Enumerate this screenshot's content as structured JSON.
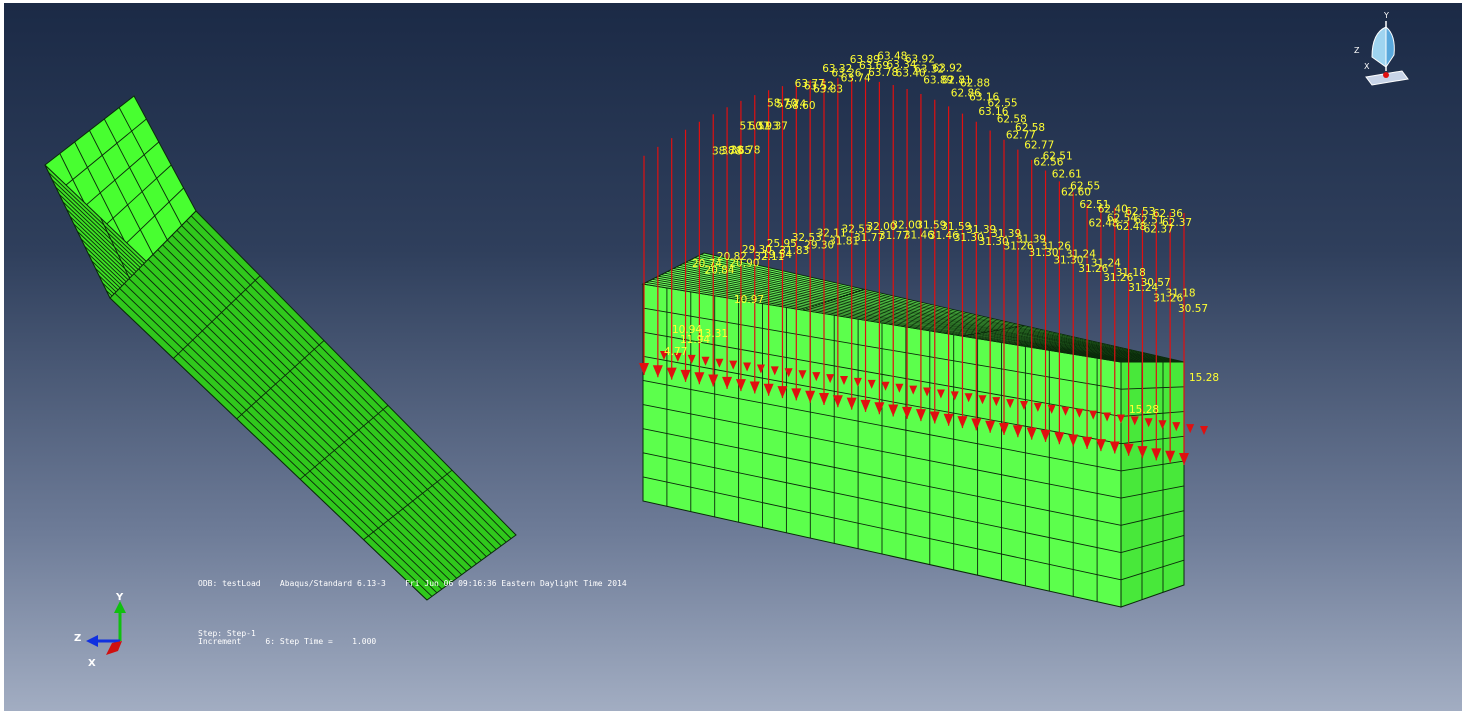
{
  "viewport": {
    "background_top": "#1b2a46",
    "background_bottom": "#a2adc2",
    "mesh_color": "#4cff44",
    "load_color": "#e01010",
    "label_color": "#ffff33"
  },
  "odb_info": {
    "line": "ODB: testLoad    Abaqus/Standard 6.13-3    Fri Jun 06 09:16:36 Eastern Daylight Time 2014"
  },
  "step_info": {
    "step": "Step: Step-1",
    "increment": "Increment     6: Step Time =    1.000"
  },
  "triad": {
    "x": "X",
    "y": "Y",
    "z": "Z"
  },
  "view_cube": {
    "x": "X",
    "y": "Y",
    "z": "Z"
  },
  "load_labels": {
    "top_row": [
      "38.78",
      "38.65",
      "38.78",
      "51.37",
      "50.93",
      "51.37",
      "58.70",
      "57.74",
      "58.60",
      "63.77",
      "63.52",
      "63.83",
      "63.32",
      "63.26",
      "63.74",
      "63.89",
      "63.69",
      "63.78",
      "63.48",
      "63.34",
      "63.40",
      "63.92",
      "63.32",
      "63.89",
      "63.92",
      "62.81",
      "62.86",
      "62.88",
      "63.16",
      "63.16",
      "62.55",
      "62.58",
      "62.77",
      "62.58",
      "62.77",
      "62.56",
      "62.51",
      "62.61",
      "62.60",
      "62.55",
      "62.51",
      "62.48",
      "62.40",
      "62.54",
      "62.48",
      "62.53",
      "62.51",
      "62.37",
      "62.36",
      "62.37"
    ],
    "middle_row": [
      "20.74",
      "20.84",
      "20.82",
      "20.90",
      "29.30",
      "32.11",
      "25.95",
      "31.83",
      "32.53",
      "29.30",
      "32.11",
      "31.81",
      "32.53",
      "31.77",
      "32.00",
      "31.77",
      "32.00",
      "31.46",
      "31.59",
      "31.46",
      "31.59",
      "31.30",
      "31.39",
      "31.30",
      "31.39",
      "31.26",
      "31.39",
      "31.30",
      "31.26",
      "31.30",
      "31.24",
      "31.26",
      "31.24",
      "31.26",
      "31.18",
      "31.24",
      "30.57",
      "31.26",
      "31.18",
      "30.57"
    ],
    "lower_row": [
      "19.54",
      "10.97",
      "10.94",
      "13.31",
      "11.94",
      "4.77",
      "15.28",
      "15.28"
    ]
  }
}
